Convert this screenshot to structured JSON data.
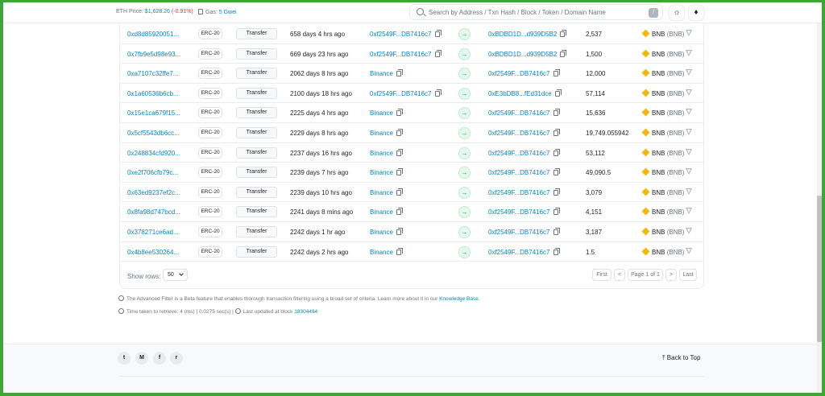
{
  "topbar": {
    "eth_price_label": "ETH Price:",
    "eth_price_value": "$1,628.26",
    "eth_price_change": "(-0.91%)",
    "gas_label": "Gas:",
    "gas_value": "5 Gwei",
    "search_placeholder": "Search by Address / Txn Hash / Block / Token / Domain Name",
    "search_shortcut": "/",
    "theme_icon": "sun-icon",
    "network_icon": "ethereum-icon"
  },
  "table": {
    "rows": [
      {
        "hash": "0xd8d85920051...",
        "badge": "ERC-20",
        "method": "Transfer",
        "age": "658 days 4 hrs ago",
        "from": "0xf2549F...DB7416c7",
        "to": "0xBDBD1D...d939D5B2",
        "quantity": "2,537",
        "token": "BNB",
        "token_sym": "(BNB)"
      },
      {
        "hash": "0x7fb9e5d98e93...",
        "badge": "ERC-20",
        "method": "Transfer",
        "age": "669 days 23 hrs ago",
        "from": "0xf2549F...DB7416c7",
        "to": "0xBDBD1D...d939D5B2",
        "quantity": "1,500",
        "token": "BNB",
        "token_sym": "(BNB)"
      },
      {
        "hash": "0xa7107c32ffe7...",
        "badge": "ERC-20",
        "method": "Transfer",
        "age": "2062 days 8 hrs ago",
        "from": "Binance",
        "to": "0xf2549F...DB7416c7",
        "quantity": "12,000",
        "token": "BNB",
        "token_sym": "(BNB)"
      },
      {
        "hash": "0x1a60536b6cb...",
        "badge": "ERC-20",
        "method": "Transfer",
        "age": "2100 days 18 hrs ago",
        "from": "0xf2549F...DB7416c7",
        "to": "0xE3bDB8...fEd31dce",
        "quantity": "57,114",
        "token": "BNB",
        "token_sym": "(BNB)"
      },
      {
        "hash": "0x15e1ca679f15...",
        "badge": "ERC-20",
        "method": "Transfer",
        "age": "2225 days 4 hrs ago",
        "from": "Binance",
        "to": "0xf2549F...DB7416c7",
        "quantity": "15,636",
        "token": "BNB",
        "token_sym": "(BNB)"
      },
      {
        "hash": "0x5cf5543db6cc...",
        "badge": "ERC-20",
        "method": "Transfer",
        "age": "2229 days 8 hrs ago",
        "from": "Binance",
        "to": "0xf2549F...DB7416c7",
        "quantity": "19,749.055942",
        "token": "BNB",
        "token_sym": "(BNB)"
      },
      {
        "hash": "0x248834cfd920...",
        "badge": "ERC-20",
        "method": "Transfer",
        "age": "2237 days 16 hrs ago",
        "from": "Binance",
        "to": "0xf2549F...DB7416c7",
        "quantity": "53,112",
        "token": "BNB",
        "token_sym": "(BNB)"
      },
      {
        "hash": "0xe2f706cfb79c...",
        "badge": "ERC-20",
        "method": "Transfer",
        "age": "2239 days 7 hrs ago",
        "from": "Binance",
        "to": "0xf2549F...DB7416c7",
        "quantity": "49,090.5",
        "token": "BNB",
        "token_sym": "(BNB)"
      },
      {
        "hash": "0x63ed9237ef2c...",
        "badge": "ERC-20",
        "method": "Transfer",
        "age": "2239 days 10 hrs ago",
        "from": "Binance",
        "to": "0xf2549F...DB7416c7",
        "quantity": "3,079",
        "token": "BNB",
        "token_sym": "(BNB)"
      },
      {
        "hash": "0x8fa98d747bcd...",
        "badge": "ERC-20",
        "method": "Transfer",
        "age": "2241 days 8 mins ago",
        "from": "Binance",
        "to": "0xf2549F...DB7416c7",
        "quantity": "4,151",
        "token": "BNB",
        "token_sym": "(BNB)"
      },
      {
        "hash": "0x378271ce6ad...",
        "badge": "ERC-20",
        "method": "Transfer",
        "age": "2242 days 1 hr ago",
        "from": "Binance",
        "to": "0xf2549F...DB7416c7",
        "quantity": "3,187",
        "token": "BNB",
        "token_sym": "(BNB)"
      },
      {
        "hash": "0x4b8ee530264...",
        "badge": "ERC-20",
        "method": "Transfer",
        "age": "2242 days 2 hrs ago",
        "from": "Binance",
        "to": "0xf2549F...DB7416c7",
        "quantity": "1.5",
        "token": "BNB",
        "token_sym": "(BNB)"
      }
    ]
  },
  "pagination": {
    "show_rows_label": "Show rows:",
    "rows_value": "50",
    "first": "First",
    "prev": "<",
    "page": "Page 1 of 1",
    "next": ">",
    "last": "Last"
  },
  "notes": {
    "filter_text": "The Advanced Filter is a Beta feature that enables thorough transaction filtering using a broad set of criteria. Learn more about it in our",
    "kb_link": "Knowledge Base",
    "period": ".",
    "time_text": "Time taken to retrieve: 4 (ms) | 0.0275 sec(s) |",
    "updated_text": "Last updated at block",
    "block_link": "18304494"
  },
  "footer": {
    "back_to_top": "Back to Top",
    "social_icons": [
      "twitter-icon",
      "medium-icon",
      "facebook-icon",
      "reddit-icon"
    ]
  },
  "colors": {
    "accent": "#0784c3",
    "frame": "#3fa535",
    "bnb": "#f0b90b",
    "arrow": "#00a186"
  }
}
